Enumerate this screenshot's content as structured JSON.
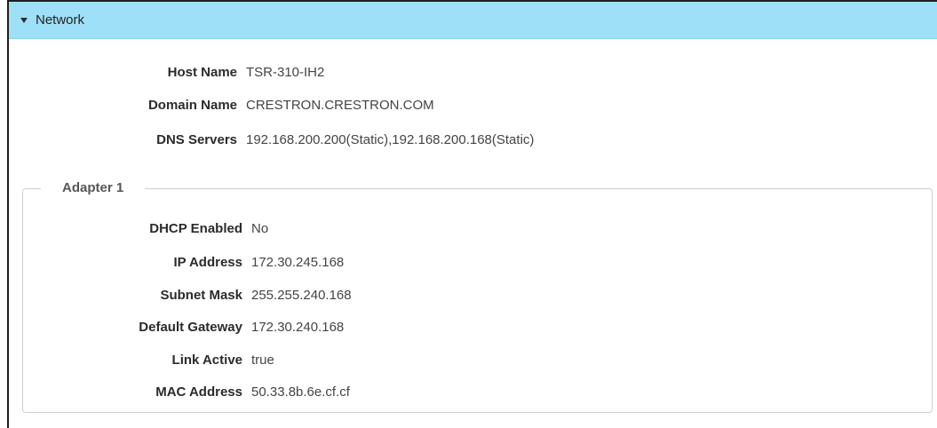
{
  "panel": {
    "title": "Network",
    "toggle_icon": "caret-down-icon"
  },
  "network": {
    "rows": [
      {
        "label": "Host Name",
        "value": "TSR-310-IH2"
      },
      {
        "label": "Domain Name",
        "value": "CRESTRON.CRESTRON.COM"
      },
      {
        "label": "DNS Servers",
        "value": "192.168.200.200(Static),192.168.200.168(Static)"
      }
    ]
  },
  "adapter": {
    "title": "Adapter 1",
    "rows": [
      {
        "label": "DHCP Enabled",
        "value": "No"
      },
      {
        "label": "IP Address",
        "value": "172.30.245.168"
      },
      {
        "label": "Subnet Mask",
        "value": "255.255.240.168"
      },
      {
        "label": "Default Gateway",
        "value": "172.30.240.168"
      },
      {
        "label": "Link Active",
        "value": "true"
      },
      {
        "label": "MAC Address",
        "value": "50.33.8b.6e.cf.cf"
      }
    ]
  },
  "colors": {
    "header_bg": "#9ee0f7",
    "border": "#1f1f1f",
    "fieldset_border": "#cfcfcf"
  }
}
